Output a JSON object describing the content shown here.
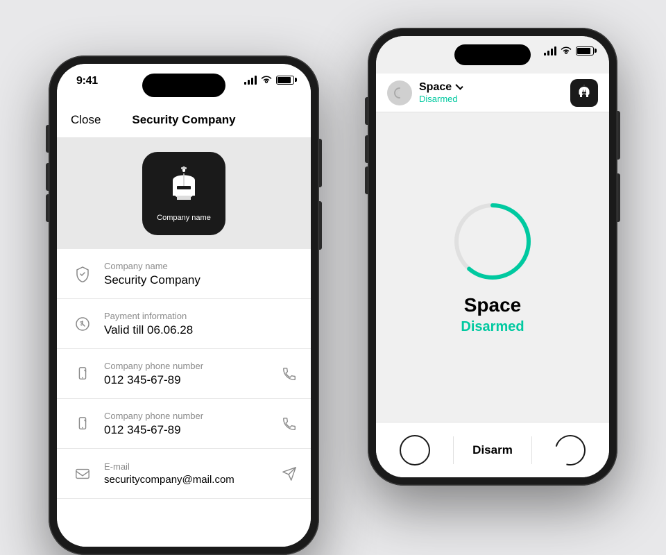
{
  "scene": {
    "background_color": "#e8e8ea"
  },
  "phone_left": {
    "status_bar": {
      "time": "9:41"
    },
    "nav": {
      "close_label": "Close",
      "title": "Security Company"
    },
    "logo": {
      "company_label": "Company name"
    },
    "info_items": [
      {
        "id": "company-name",
        "label": "Company name",
        "value": "Security Company",
        "has_action": false
      },
      {
        "id": "payment",
        "label": "Payment information",
        "value": "Valid till 06.06.28",
        "has_action": false
      },
      {
        "id": "phone1",
        "label": "Company phone number",
        "value": "012 345-67-89",
        "has_action": true
      },
      {
        "id": "phone2",
        "label": "Company phone number",
        "value": "012 345-67-89",
        "has_action": true
      },
      {
        "id": "email",
        "label": "E-mail",
        "value": "securitycompany@mail.com",
        "has_action": true
      }
    ]
  },
  "phone_right": {
    "header": {
      "space_label": "Space",
      "status_label": "Disarmed"
    },
    "main": {
      "name": "Space",
      "status": "Disarmed"
    },
    "bottom": {
      "disarm_label": "Disarm"
    }
  }
}
